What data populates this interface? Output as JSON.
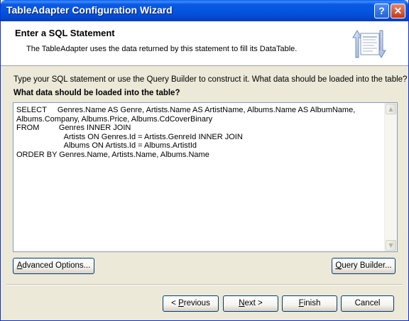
{
  "window": {
    "title": "TableAdapter Configuration Wizard",
    "help_glyph": "?",
    "close_glyph": "✕"
  },
  "header": {
    "title": "Enter a SQL Statement",
    "description": "The TableAdapter uses the data returned by this statement to fill its DataTable.",
    "icon": "database-table-icon"
  },
  "body": {
    "instructions": "Type your SQL statement or use the Query Builder to construct it. What data should be loaded into the table?",
    "question": "What data should be loaded into the table?",
    "sql_text": "SELECT     Genres.Name AS Genre, Artists.Name AS ArtistName, Albums.Name AS AlbumName,\nAlbums.Company, Albums.Price, Albums.CdCoverBinary\nFROM         Genres INNER JOIN\n                      Artists ON Genres.Id = Artists.GenreId INNER JOIN\n                      Albums ON Artists.Id = Albums.ArtistId\nORDER BY Genres.Name, Artists.Name, Albums.Name"
  },
  "buttons": {
    "advanced": {
      "accel": "A",
      "rest": "dvanced Options..."
    },
    "query_builder": {
      "accel": "Q",
      "rest": "uery Builder..."
    },
    "previous": {
      "pre": "< ",
      "accel": "P",
      "rest": "revious"
    },
    "next": {
      "accel": "N",
      "rest": "ext >"
    },
    "finish": {
      "accel": "F",
      "rest": "inish"
    },
    "cancel": {
      "label": "Cancel"
    }
  },
  "colors": {
    "titlebar": "#0554e0",
    "face": "#ece9d8",
    "button_border": "#003c74"
  }
}
